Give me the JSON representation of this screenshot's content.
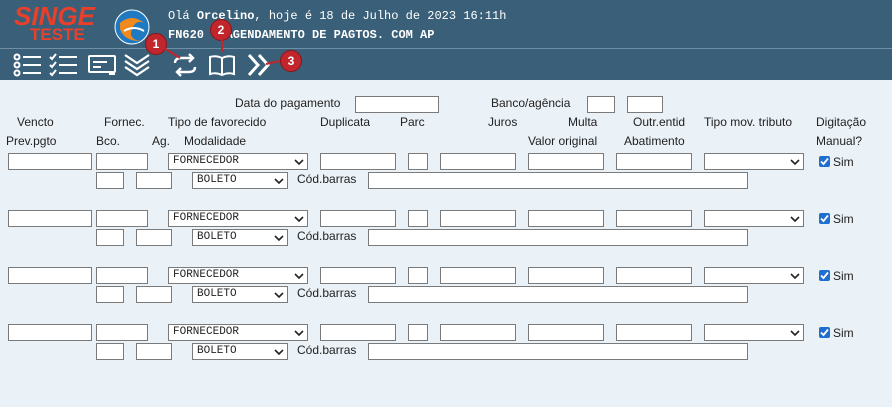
{
  "header": {
    "logo_top": "SINGE",
    "logo_bottom": "TESTE",
    "greeting_prefix": "Olá ",
    "user_name": "Orcelino",
    "greeting_suffix": ", hoje é 18 de Julho de 2023 16:11h",
    "screen_title": "FN620 - AGENDAMENTO DE PAGTOS. COM AP"
  },
  "toolbar": {
    "badges": [
      "1",
      "2",
      "3"
    ]
  },
  "form": {
    "payment_date_label": "Data do pagamento",
    "bank_label": "Banco/agência",
    "columns": {
      "vencto": "Vencto",
      "prev_pgto": "Prev.pgto",
      "fornec": "Fornec.",
      "bco": "Bco.",
      "ag": "Ag.",
      "tipo_favorecido": "Tipo de favorecido",
      "modalidade": "Modalidade",
      "duplicata": "Duplicata",
      "parc": "Parc",
      "juros": "Juros",
      "multa": "Multa",
      "valor_original": "Valor original",
      "outr_entid": "Outr.entid",
      "abatimento": "Abatimento",
      "tipo_mov_tributo": "Tipo mov. tributo",
      "digitacao": "Digitação",
      "manual": "Manual?"
    },
    "rows": [
      {
        "favorecido": "FORNECEDOR",
        "modalidade": "BOLETO",
        "barcode_label": "Cód.barras",
        "manual_label": "Sim"
      },
      {
        "favorecido": "FORNECEDOR",
        "modalidade": "BOLETO",
        "barcode_label": "Cód.barras",
        "manual_label": "Sim"
      },
      {
        "favorecido": "FORNECEDOR",
        "modalidade": "BOLETO",
        "barcode_label": "Cód.barras",
        "manual_label": "Sim"
      },
      {
        "favorecido": "FORNECEDOR",
        "modalidade": "BOLETO",
        "barcode_label": "Cód.barras",
        "manual_label": "Sim"
      }
    ]
  },
  "colors": {
    "header_bg": "#3a5f78",
    "page_bg": "#eaf1f7",
    "logo": "#e8402a",
    "badge": "#c0262b",
    "checkbox": "#1f6fd1"
  },
  "icons": [
    "list-icon",
    "checklist-icon",
    "card-icon",
    "collapse-icon",
    "refresh-icon",
    "book-icon",
    "next-icon",
    "globe-logo-icon"
  ]
}
